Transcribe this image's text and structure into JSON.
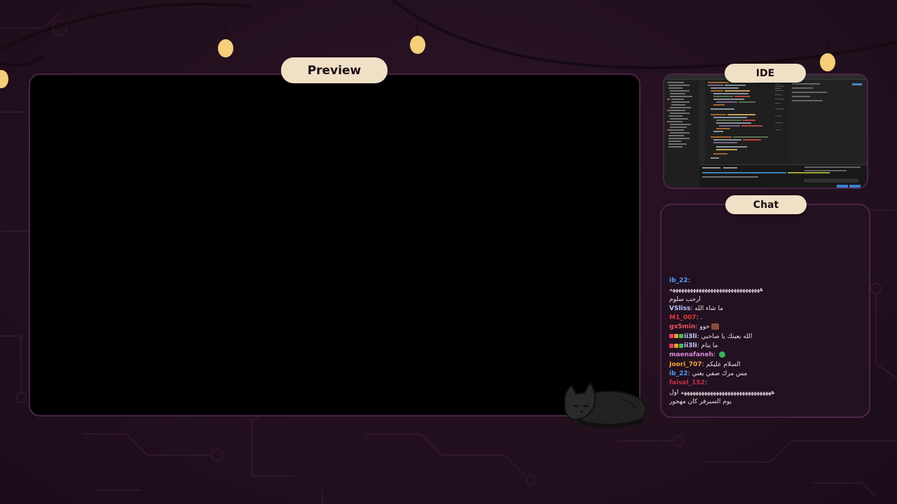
{
  "panels": {
    "preview_label": "Preview",
    "ide_label": "IDE",
    "chat_label": "Chat"
  },
  "colors": {
    "background": "#23101f",
    "frame_border": "#4a2546",
    "pill": "#f0e0c6",
    "bulb": "#f7cf7a"
  },
  "chat": {
    "messages": [
      {
        "user": "ib_22",
        "user_color": "#4aa3ff",
        "badges": [],
        "text": "هههههههههههههههههههههههههههههههه",
        "emote": ""
      },
      {
        "user": "",
        "user_color": "#ece2e6",
        "badges": [],
        "text": "ارحب سلوم",
        "emote": ""
      },
      {
        "user": "VSliss",
        "user_color": "#b6c9ff",
        "badges": [],
        "text": "ما شاء الله",
        "emote": ""
      },
      {
        "user": "M1_007",
        "user_color": "#e03a3a",
        "badges": [],
        "text": ".",
        "emote": ""
      },
      {
        "user": "gx5min",
        "user_color": "#e8565c",
        "badges": [],
        "text": "حوو",
        "emote": "brown"
      },
      {
        "user": "ii3li",
        "user_color": "#c9d4ff",
        "badges": [
          "#e04060",
          "#f0a020",
          "#3fbf5a"
        ],
        "text": "الله يعينك يا صاحبي",
        "emote": ""
      },
      {
        "user": "ii3li",
        "user_color": "#c9d4ff",
        "badges": [
          "#e04060",
          "#f0a020",
          "#3fbf5a"
        ],
        "text": "ما ينام",
        "emote": ""
      },
      {
        "user": "maenafaneh",
        "user_color": "#d58bd6",
        "badges": [],
        "text": "",
        "emote": "green"
      },
      {
        "user": "Joori_707",
        "user_color": "#f2a93b",
        "badges": [],
        "text": "السلام عليكم",
        "emote": ""
      },
      {
        "user": "ib_22",
        "user_color": "#4aa3ff",
        "badges": [],
        "text": "مس مرك صفي بعني",
        "emote": ""
      },
      {
        "user": "faisal_152",
        "user_color": "#c0334a",
        "badges": [],
        "text": "هههههههههههههههههههههههههههههههه اول",
        "emote": ""
      },
      {
        "user": "",
        "user_color": "#ece2e6",
        "badges": [],
        "text": "يوم السيرفر كان مهجور",
        "emote": ""
      }
    ]
  }
}
